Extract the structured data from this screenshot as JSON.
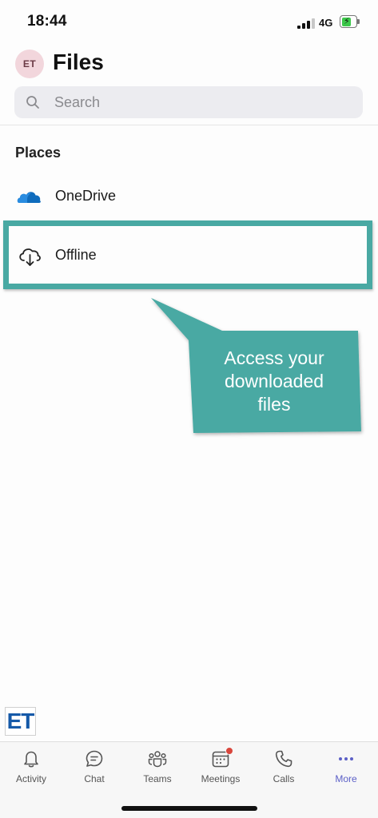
{
  "status_bar": {
    "time": "18:44",
    "network": "4G",
    "battery_fraction": 0.65,
    "signal_bars": 3
  },
  "header": {
    "avatar_initials": "ET",
    "title": "Files"
  },
  "search": {
    "placeholder": "Search"
  },
  "places": {
    "heading": "Places",
    "items": [
      {
        "label": "OneDrive",
        "icon": "onedrive-cloud-icon"
      },
      {
        "label": "Offline",
        "icon": "cloud-download-icon"
      }
    ]
  },
  "callout": {
    "lines": [
      "Access your",
      "downloaded",
      "files"
    ],
    "color": "#49a9a3"
  },
  "watermark": {
    "text": "ET"
  },
  "tabs": [
    {
      "label": "Activity",
      "icon": "bell-icon"
    },
    {
      "label": "Chat",
      "icon": "chat-icon"
    },
    {
      "label": "Teams",
      "icon": "teams-icon"
    },
    {
      "label": "Meetings",
      "icon": "calendar-icon",
      "badge": true
    },
    {
      "label": "Calls",
      "icon": "phone-icon"
    },
    {
      "label": "More",
      "icon": "more-icon",
      "active": true
    }
  ],
  "colors": {
    "accent": "#5b5fc7",
    "onedrive": "#0f6cbd",
    "badge": "#d9463c"
  }
}
